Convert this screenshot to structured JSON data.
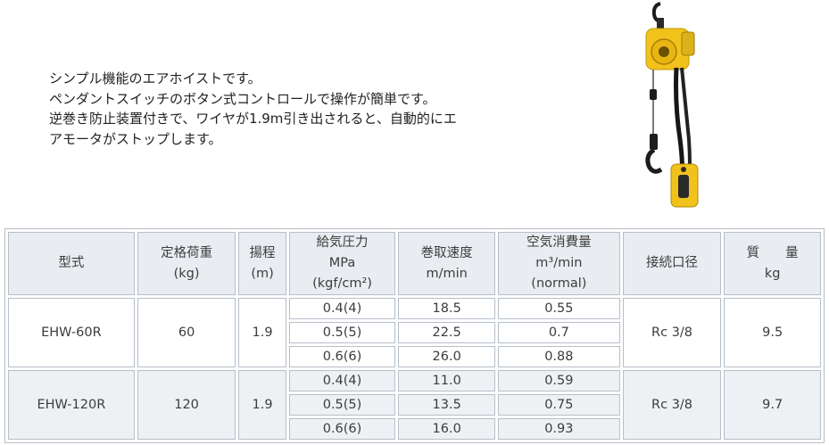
{
  "description": {
    "lines": [
      "シンプル機能のエアホイストです。",
      "ペンダントスイッチのボタン式コントロールで操作が簡単です。",
      "逆巻き防止装置付きで、ワイヤが1.9m引き出されると、自動的にエ",
      "アモータがストップします。"
    ]
  },
  "product_image": {
    "icon": "air-hoist-photo",
    "body_color": "#f2c21c",
    "hose_color": "#1a1a1a"
  },
  "table": {
    "headers": {
      "model": "型式",
      "rated_load": [
        "定格荷重",
        "(kg)"
      ],
      "lift": [
        "揚程",
        "(m)"
      ],
      "air_pressure": [
        "給気圧力",
        "MPa",
        "(kgf/cm²)"
      ],
      "speed": [
        "巻取速度",
        "m/min"
      ],
      "air_consumption": [
        "空気消費量",
        "m³/min",
        "(normal)"
      ],
      "port": "接続口径",
      "mass": [
        "質　　量",
        "kg"
      ]
    },
    "rows": [
      {
        "model": "EHW-60R",
        "rated_load": "60",
        "lift": "1.9",
        "sub": [
          {
            "pressure": "0.4(4)",
            "speed": "18.5",
            "consumption": "0.55"
          },
          {
            "pressure": "0.5(5)",
            "speed": "22.5",
            "consumption": "0.7"
          },
          {
            "pressure": "0.6(6)",
            "speed": "26.0",
            "consumption": "0.88"
          }
        ],
        "port": "Rc 3/8",
        "mass": "9.5"
      },
      {
        "model": "EHW-120R",
        "rated_load": "120",
        "lift": "1.9",
        "sub": [
          {
            "pressure": "0.4(4)",
            "speed": "11.0",
            "consumption": "0.59"
          },
          {
            "pressure": "0.5(5)",
            "speed": "13.5",
            "consumption": "0.75"
          },
          {
            "pressure": "0.6(6)",
            "speed": "16.0",
            "consumption": "0.93"
          }
        ],
        "port": "Rc 3/8",
        "mass": "9.7"
      }
    ]
  }
}
